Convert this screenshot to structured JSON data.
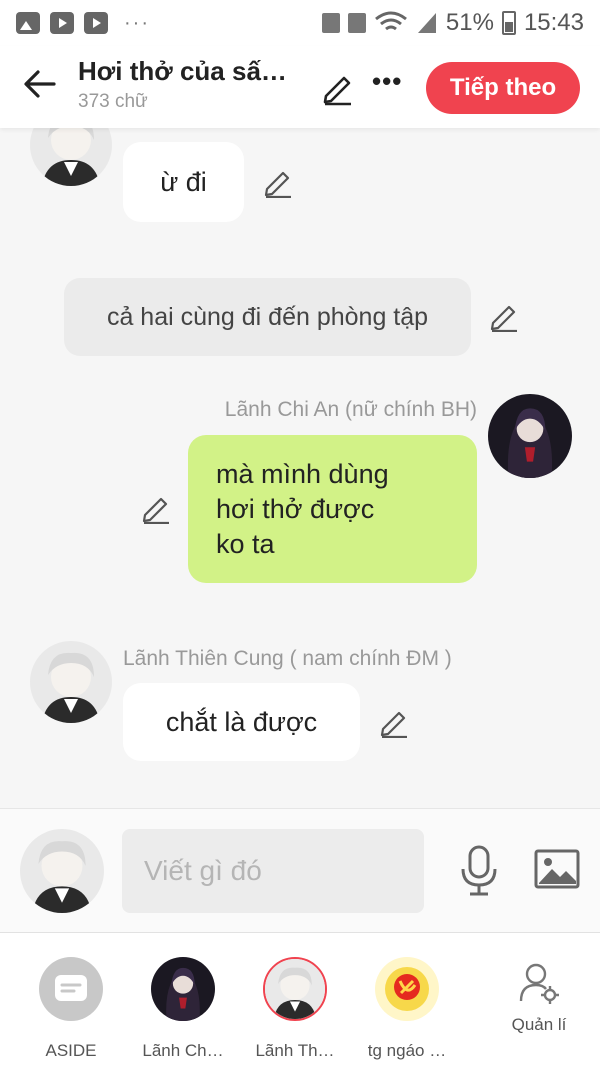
{
  "status": {
    "battery": "51%",
    "time": "15:43",
    "more": "···"
  },
  "header": {
    "title": "Hơi thở của sấ…",
    "word_count": "373 chữ",
    "more": "•••",
    "next_button": "Tiếp theo"
  },
  "messages": [
    {
      "type": "left",
      "text": "ừ đi"
    },
    {
      "type": "narration",
      "text": "cả hai cùng đi đến phòng tập"
    },
    {
      "type": "right",
      "speaker": "Lãnh Chi An (nữ chính BH)",
      "lines": [
        "mà mình dùng",
        "hơi thở được",
        "ko ta"
      ]
    },
    {
      "type": "left",
      "speaker": "Lãnh Thiên Cung ( nam chính ĐM )",
      "text": "chắt là được"
    }
  ],
  "input": {
    "placeholder": "Viết gì đó"
  },
  "characters": [
    {
      "name": "ASIDE",
      "icon": "aside-chat-icon"
    },
    {
      "name": "Lãnh Ch…",
      "icon": "dark-hair-girl-avatar"
    },
    {
      "name": "Lãnh Th…",
      "icon": "white-hair-boy-avatar"
    },
    {
      "name": "tg ngáo …",
      "icon": "hammer-sickle-avatar"
    },
    {
      "name": "Quản lí",
      "icon": "manage-user-gear-icon"
    }
  ],
  "colors": {
    "accent": "#f0434f",
    "right_bubble": "#d2f287",
    "background": "#f6f6f6"
  }
}
